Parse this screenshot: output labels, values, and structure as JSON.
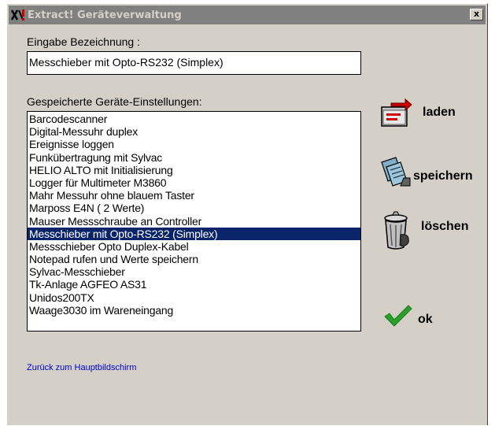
{
  "window": {
    "title": "Extract! Geräteverwaltung",
    "close_label": "x"
  },
  "form": {
    "name_label": "Eingabe Bezeichnung :",
    "name_value": "Messchieber mit Opto-RS232 (Simplex)",
    "saved_label": "Gespeicherte Geräte-Einstellungen:"
  },
  "devices": {
    "items": [
      "Barcodescanner",
      "Digital-Messuhr duplex",
      "Ereignisse loggen",
      "Funkübertragung mit Sylvac",
      "HELIO ALTO  mit Initialisierung",
      "Logger für Multimeter M3860",
      "Mahr Messuhr ohne blauem Taster",
      "Marposs E4N ( 2 Werte)",
      "Mauser Messschraube an Controller",
      "Messchieber mit Opto-RS232 (Simplex)",
      "Messschieber Opto Duplex-Kabel",
      "Notepad rufen und Werte speichern",
      "Sylvac-Messchieber",
      "Tk-Anlage AGFEO AS31",
      "Unidos200TX",
      "Waage3030 im Wareneingang"
    ],
    "selected": "Messchieber mit Opto-RS232 (Simplex)"
  },
  "actions": {
    "load_label": "laden",
    "save_label": "speichern",
    "delete_label": "löschen",
    "ok_label": "ok"
  },
  "icons": {
    "app": "app-logo-icon",
    "load": "load-folder-icon",
    "save": "save-documents-icon",
    "delete": "trash-can-icon",
    "ok": "checkmark-icon"
  },
  "colors": {
    "title_bar": "#808080",
    "dialog_bg": "#d4d0c8",
    "selection": "#0a246a",
    "link": "#0000cc",
    "check": "#2aa02a"
  },
  "footer": {
    "back_link": "Zurück zum Hauptbildschirm"
  }
}
